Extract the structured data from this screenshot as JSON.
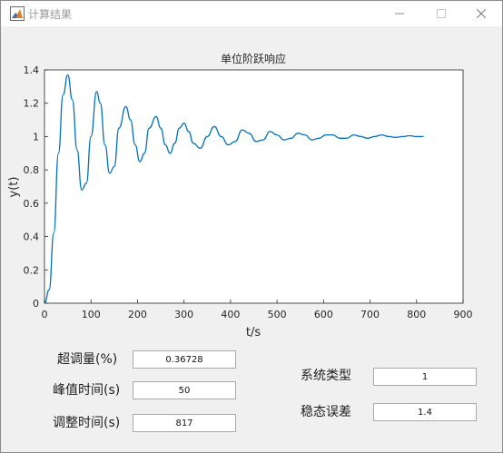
{
  "window": {
    "title": "计算结果",
    "icon": "matlab-figure-icon"
  },
  "chart_data": {
    "type": "line",
    "title": "单位阶跃响应",
    "xlabel": "t/s",
    "ylabel": "y(t)",
    "xlim": [
      0,
      900
    ],
    "ylim": [
      0,
      1.4
    ],
    "x_ticks": [
      "0",
      "100",
      "200",
      "300",
      "400",
      "500",
      "600",
      "700",
      "800",
      "900"
    ],
    "y_ticks": [
      "0",
      "0.2",
      "0.4",
      "0.6",
      "0.8",
      "1",
      "1.2",
      "1.4"
    ],
    "grid": false,
    "color": "#0072bd",
    "series": [
      {
        "x": [
          0,
          10,
          20,
          30,
          40,
          50,
          60,
          70,
          80,
          90,
          100,
          112,
          120,
          130,
          140,
          150,
          160,
          175,
          185,
          195,
          205,
          215,
          225,
          240,
          250,
          260,
          270,
          280,
          290,
          300,
          310,
          320,
          335,
          350,
          365,
          380,
          395,
          410,
          425,
          440,
          455,
          470,
          485,
          500,
          515,
          530,
          545,
          560,
          575,
          590,
          605,
          620,
          635,
          650,
          665,
          680,
          695,
          710,
          725,
          740,
          755,
          770,
          785,
          800,
          815
        ],
        "y": [
          0,
          0.08,
          0.42,
          0.9,
          1.25,
          1.37,
          1.22,
          0.92,
          0.68,
          0.72,
          1.0,
          1.27,
          1.2,
          0.95,
          0.78,
          0.82,
          1.05,
          1.18,
          1.1,
          0.95,
          0.85,
          0.9,
          1.05,
          1.12,
          1.05,
          0.95,
          0.9,
          0.96,
          1.05,
          1.08,
          1.03,
          0.96,
          0.93,
          1.0,
          1.06,
          1.0,
          0.95,
          0.97,
          1.04,
          1.02,
          0.97,
          0.98,
          1.03,
          1.01,
          0.98,
          0.99,
          1.02,
          1.01,
          0.98,
          0.99,
          1.01,
          1.01,
          0.99,
          0.99,
          1.01,
          1.0,
          0.99,
          1.0,
          1.01,
          1.0,
          0.995,
          1.0,
          1.005,
          1.0,
          1.0
        ]
      }
    ]
  },
  "results": {
    "overshoot_label": "超调量(%)",
    "overshoot_value": "0.36728",
    "peak_time_label": "峰值时间(s)",
    "peak_time_value": "50",
    "settling_time_label": "调整时间(s)",
    "settling_time_value": "817",
    "system_type_label": "系统类型",
    "system_type_value": "1",
    "steady_state_error_label": "稳态误差",
    "steady_state_error_value": "1.4"
  }
}
